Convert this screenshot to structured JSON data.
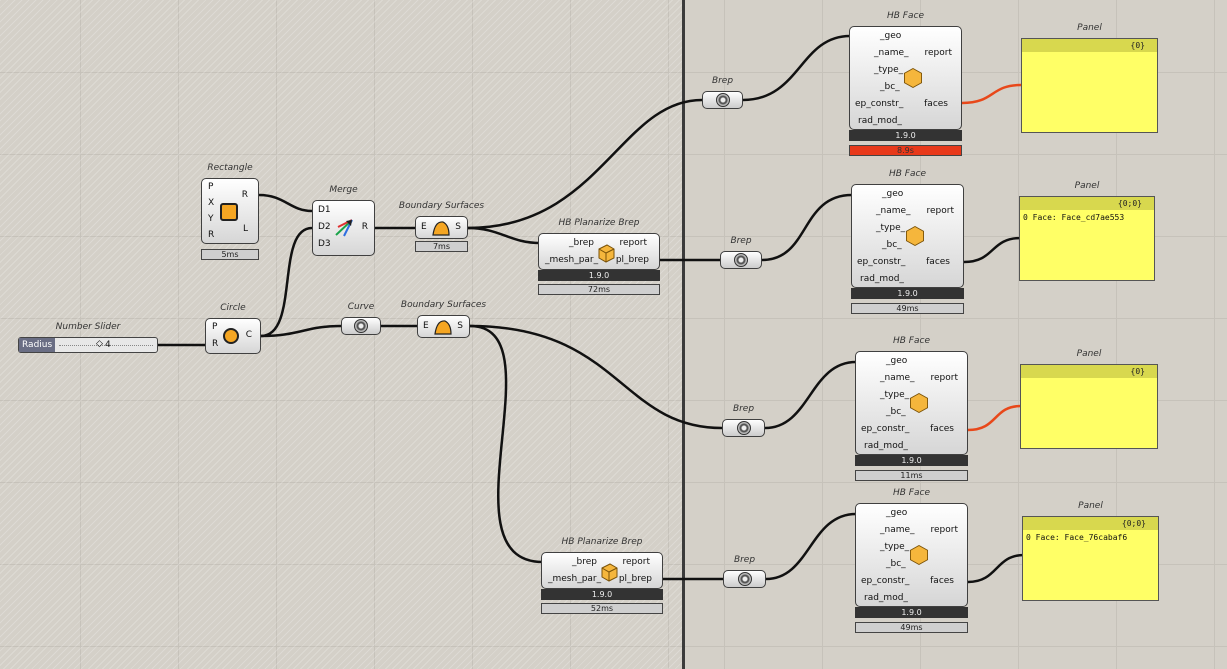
{
  "slider": {
    "title": "Number Slider",
    "name": "Radius",
    "value": "4",
    "knob": "◇"
  },
  "rectangle": {
    "title": "Rectangle",
    "inputs": [
      "P",
      "X",
      "Y",
      "R"
    ],
    "outputs": [
      "R",
      "L"
    ],
    "time": "5ms"
  },
  "circle": {
    "title": "Circle",
    "inputs": [
      "P",
      "R"
    ],
    "outputs": [
      "C"
    ]
  },
  "merge": {
    "title": "Merge",
    "inputs": [
      "D1",
      "D2",
      "D3"
    ],
    "outputs": [
      "R"
    ]
  },
  "boundary1": {
    "title": "Boundary Surfaces",
    "input": "E",
    "output": "S",
    "time": "7ms"
  },
  "curve": {
    "title": "Curve"
  },
  "boundary2": {
    "title": "Boundary Surfaces",
    "input": "E",
    "output": "S"
  },
  "planarize1": {
    "title": "HB Planarize Brep",
    "inputs": [
      "_brep",
      "_mesh_par_"
    ],
    "outputs": [
      "report",
      "pl_brep"
    ],
    "version": "1.9.0",
    "time": "72ms"
  },
  "planarize2": {
    "title": "HB Planarize Brep",
    "inputs": [
      "_brep",
      "_mesh_par_"
    ],
    "outputs": [
      "report",
      "pl_brep"
    ],
    "version": "1.9.0",
    "time": "52ms"
  },
  "brep1": {
    "title": "Brep"
  },
  "brep2": {
    "title": "Brep"
  },
  "brep3": {
    "title": "Brep"
  },
  "brep4": {
    "title": "Brep"
  },
  "hbface1": {
    "title": "HB Face",
    "inputs": [
      "_geo",
      "_name_",
      "_type_",
      "_bc_",
      "ep_constr_",
      "rad_mod_"
    ],
    "outputs": [
      "report",
      "faces"
    ],
    "version": "1.9.0",
    "time": "8.9s"
  },
  "hbface2": {
    "title": "HB Face",
    "inputs": [
      "_geo",
      "_name_",
      "_type_",
      "_bc_",
      "ep_constr_",
      "rad_mod_"
    ],
    "outputs": [
      "report",
      "faces"
    ],
    "version": "1.9.0",
    "time": "49ms"
  },
  "hbface3": {
    "title": "HB Face",
    "inputs": [
      "_geo",
      "_name_",
      "_type_",
      "_bc_",
      "ep_constr_",
      "rad_mod_"
    ],
    "outputs": [
      "report",
      "faces"
    ],
    "version": "1.9.0",
    "time": "11ms"
  },
  "hbface4": {
    "title": "HB Face",
    "inputs": [
      "_geo",
      "_name_",
      "_type_",
      "_bc_",
      "ep_constr_",
      "rad_mod_"
    ],
    "outputs": [
      "report",
      "faces"
    ],
    "version": "1.9.0",
    "time": "49ms"
  },
  "panel1": {
    "title": "Panel",
    "header": "{0}",
    "line": ""
  },
  "panel2": {
    "title": "Panel",
    "header": "{0;0}",
    "line": "0 Face: Face_cd7ae553"
  },
  "panel3": {
    "title": "Panel",
    "header": "{0}",
    "line": ""
  },
  "panel4": {
    "title": "Panel",
    "header": "{0;0}",
    "line": "0 Face: Face_76cabaf6"
  },
  "colors": {
    "wire": "#111111",
    "wire_error": "#e8481a",
    "panel": "#ffff66",
    "error": "#e8391a",
    "canvas": "#d4d0c8"
  }
}
